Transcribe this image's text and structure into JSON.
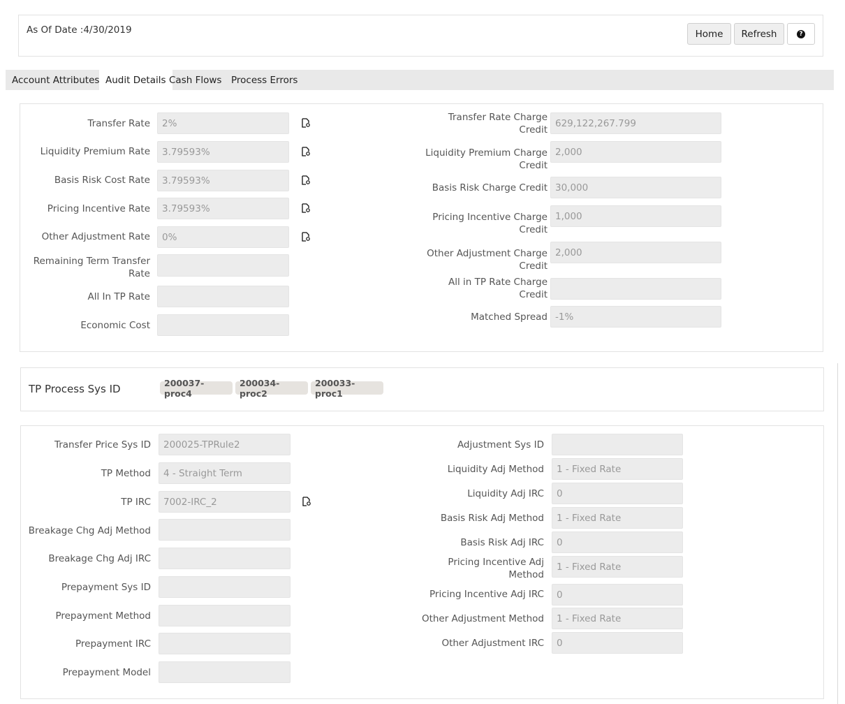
{
  "header": {
    "as_of_date": "As Of Date :4/30/2019",
    "home_label": "Home",
    "refresh_label": "Refresh",
    "help_glyph": "?"
  },
  "tabs": [
    {
      "label": "Account Attributes"
    },
    {
      "label": "Audit Details"
    },
    {
      "label": "Cash Flows"
    },
    {
      "label": "Process Errors"
    }
  ],
  "rates": {
    "left": [
      {
        "label": "Transfer Rate",
        "value": "2%",
        "icon": "document-view-icon"
      },
      {
        "label": "Liquidity Premium Rate",
        "value": "3.79593%",
        "icon": "document-view-icon"
      },
      {
        "label": "Basis Risk Cost Rate",
        "value": "3.79593%",
        "icon": "document-view-icon"
      },
      {
        "label": "Pricing Incentive Rate",
        "value": "3.79593%",
        "icon": "document-view-icon"
      },
      {
        "label": "Other Adjustment Rate",
        "value": "0%",
        "icon": "document-view-icon"
      },
      {
        "label": "Remaining Term Transfer Rate",
        "value": ""
      },
      {
        "label": "All In TP Rate",
        "value": ""
      },
      {
        "label": "Economic Cost",
        "value": ""
      }
    ],
    "right": [
      {
        "label": "Transfer Rate Charge Credit",
        "value": "629,122,267.799"
      },
      {
        "label": "Liquidity Premium Charge Credit",
        "value": "2,000"
      },
      {
        "label": "Basis Risk Charge Credit",
        "value": "30,000"
      },
      {
        "label": "Pricing Incentive Charge Credit",
        "value": "1,000"
      },
      {
        "label": "Other Adjustment Charge Credit",
        "value": "2,000"
      },
      {
        "label": "All in TP Rate Charge Credit",
        "value": ""
      },
      {
        "label": "Matched Spread",
        "value": "-1%"
      }
    ]
  },
  "tp_process": {
    "label": "TP Process Sys ID",
    "ids": [
      "200037-proc4",
      "200034-proc2",
      "200033-proc1"
    ]
  },
  "rules": {
    "left": [
      {
        "label": "Transfer Price Sys ID",
        "value": "200025-TPRule2"
      },
      {
        "label": "TP Method",
        "value": "4 - Straight Term"
      },
      {
        "label": "TP IRC",
        "value": "7002-IRC_2",
        "icon": "document-view-icon"
      },
      {
        "label": "Breakage Chg Adj Method",
        "value": ""
      },
      {
        "label": "Breakage Chg Adj IRC",
        "value": ""
      },
      {
        "label": "Prepayment Sys ID",
        "value": ""
      },
      {
        "label": "Prepayment Method",
        "value": ""
      },
      {
        "label": "Prepayment IRC",
        "value": ""
      },
      {
        "label": "Prepayment Model",
        "value": ""
      }
    ],
    "right": [
      {
        "label": "Adjustment Sys ID",
        "value": ""
      },
      {
        "label": "Liquidity Adj Method",
        "value": "1 - Fixed Rate"
      },
      {
        "label": "Liquidity Adj IRC",
        "value": "0"
      },
      {
        "label": "Basis Risk Adj Method",
        "value": "1 - Fixed Rate"
      },
      {
        "label": "Basis Risk Adj IRC",
        "value": "0"
      },
      {
        "label": "Pricing Incentive Adj Method",
        "value": "1 - Fixed Rate"
      },
      {
        "label": "Pricing Incentive Adj IRC",
        "value": "0"
      },
      {
        "label": "Other Adjustment Method",
        "value": "1 - Fixed Rate"
      },
      {
        "label": "Other Adjustment IRC",
        "value": "0"
      }
    ]
  }
}
